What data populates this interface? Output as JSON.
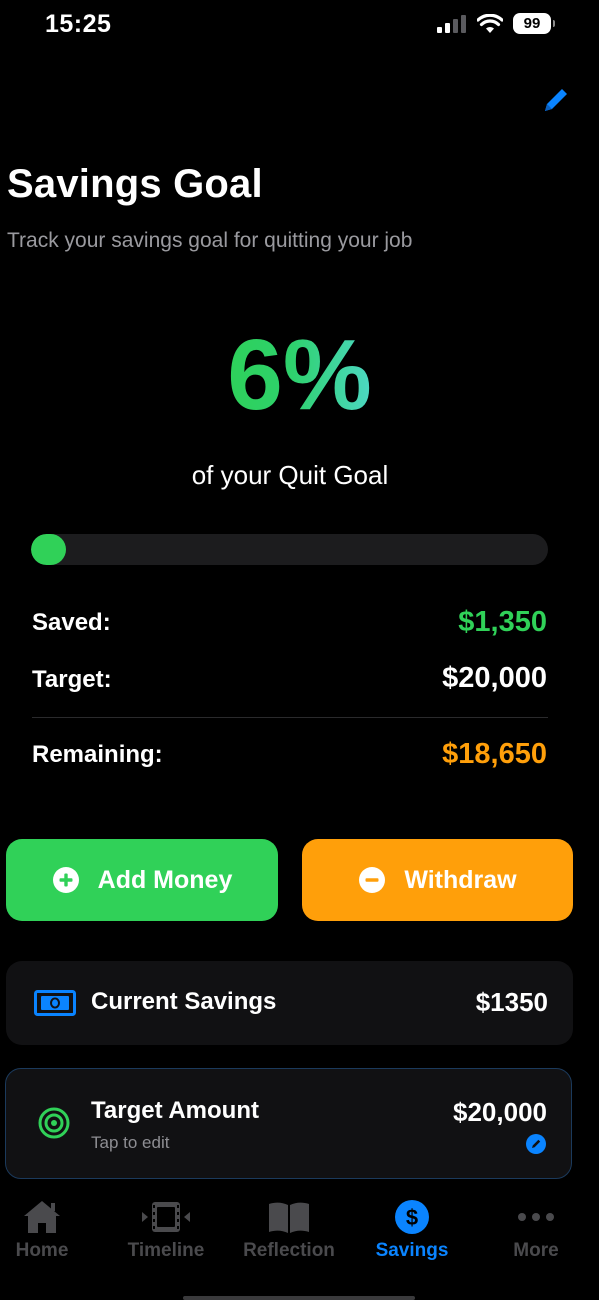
{
  "status": {
    "time": "15:25",
    "battery": "99"
  },
  "header": {
    "title": "Savings Goal",
    "subtitle": "Track your savings goal for quitting your job",
    "edit_icon": "pencil-icon"
  },
  "progress": {
    "percent_label": "6%",
    "caption": "of your Quit Goal",
    "fraction": 0.0675
  },
  "summary": {
    "saved_label": "Saved:",
    "saved_value": "$1,350",
    "target_label": "Target:",
    "target_value": "$20,000",
    "remaining_label": "Remaining:",
    "remaining_value": "$18,650"
  },
  "actions": {
    "add_label": "Add Money",
    "withdraw_label": "Withdraw"
  },
  "cards": {
    "current": {
      "title": "Current Savings",
      "value": "$1350",
      "icon": "banknote-icon"
    },
    "target": {
      "title": "Target Amount",
      "hint": "Tap to edit",
      "value": "$20,000",
      "icon": "target-icon"
    }
  },
  "tabs": [
    {
      "label": "Home",
      "icon": "house-icon"
    },
    {
      "label": "Timeline",
      "icon": "film-timeline-icon"
    },
    {
      "label": "Reflection",
      "icon": "book-icon"
    },
    {
      "label": "Savings",
      "icon": "dollar-icon"
    },
    {
      "label": "More",
      "icon": "ellipsis-icon"
    }
  ],
  "active_tab": "Savings",
  "colors": {
    "green": "#30d158",
    "orange": "#ff9f0a",
    "blue": "#0a84ff",
    "inactive": "#4a4a4d",
    "card": "#111113"
  }
}
